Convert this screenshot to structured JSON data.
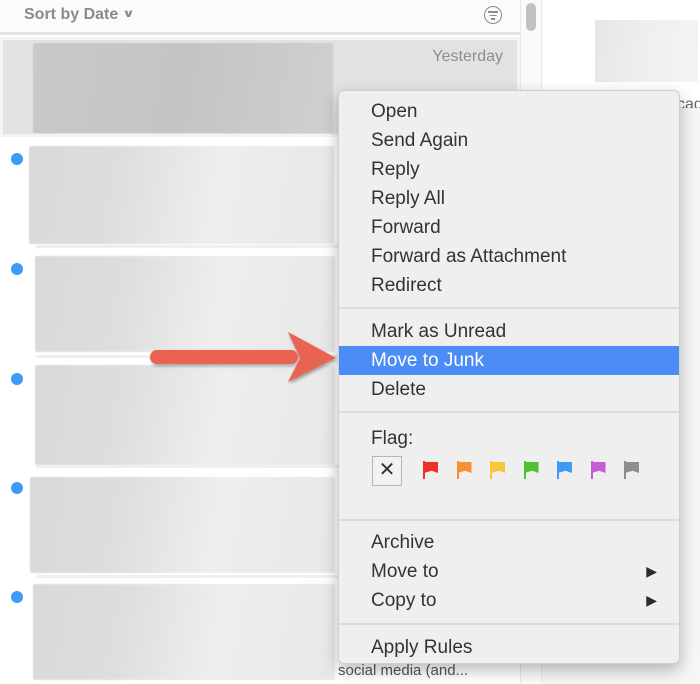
{
  "header": {
    "sort_label": "Sort by Date",
    "sort_icon": "chevron-down-icon",
    "filter_icon": "filter-icon"
  },
  "messages": [
    {
      "date": "Yesterday",
      "unread": false,
      "selected": true,
      "preview_fragment": ""
    },
    {
      "unread": true,
      "preview_fragment": ""
    },
    {
      "unread": true,
      "preview_fragment": ""
    },
    {
      "unread": true,
      "preview_fragment": ""
    },
    {
      "unread": true,
      "preview_fragment": ""
    },
    {
      "unread": true,
      "preview_fragment": "social media (and..."
    }
  ],
  "reading_pane": {
    "peek_text": "cag"
  },
  "context_menu": {
    "groups": [
      [
        "Open",
        "Send Again",
        "Reply",
        "Reply All",
        "Forward",
        "Forward as Attachment",
        "Redirect"
      ],
      [
        "Mark as Unread",
        "Move to Junk",
        "Delete"
      ],
      [
        "Archive",
        "Move to",
        "Copy to"
      ],
      [
        "Apply Rules"
      ]
    ],
    "items": {
      "open": "Open",
      "send_again": "Send Again",
      "reply": "Reply",
      "reply_all": "Reply All",
      "forward": "Forward",
      "forward_attachment": "Forward as Attachment",
      "redirect": "Redirect",
      "mark_unread": "Mark as Unread",
      "move_junk": "Move to Junk",
      "delete": "Delete",
      "archive": "Archive",
      "move_to": "Move to",
      "copy_to": "Copy to",
      "apply_rules": "Apply Rules"
    },
    "highlighted": "Move to Junk",
    "submenu_arrow": "▶",
    "flag": {
      "label": "Flag:",
      "clear_glyph": "✕",
      "colors": [
        {
          "name": "red",
          "hex": "#ee2f25"
        },
        {
          "name": "orange",
          "hex": "#f5922f"
        },
        {
          "name": "yellow",
          "hex": "#f6c73a"
        },
        {
          "name": "green",
          "hex": "#4cc233"
        },
        {
          "name": "blue",
          "hex": "#3d9bf7"
        },
        {
          "name": "purple",
          "hex": "#c75ad9"
        },
        {
          "name": "gray",
          "hex": "#8e8e8e"
        }
      ]
    }
  },
  "annotation": {
    "type": "arrow",
    "color": "#e96452",
    "points_to": "Move to Junk"
  },
  "colors": {
    "highlight": "#4b8cf6",
    "unread_dot": "#3d9bf7"
  }
}
